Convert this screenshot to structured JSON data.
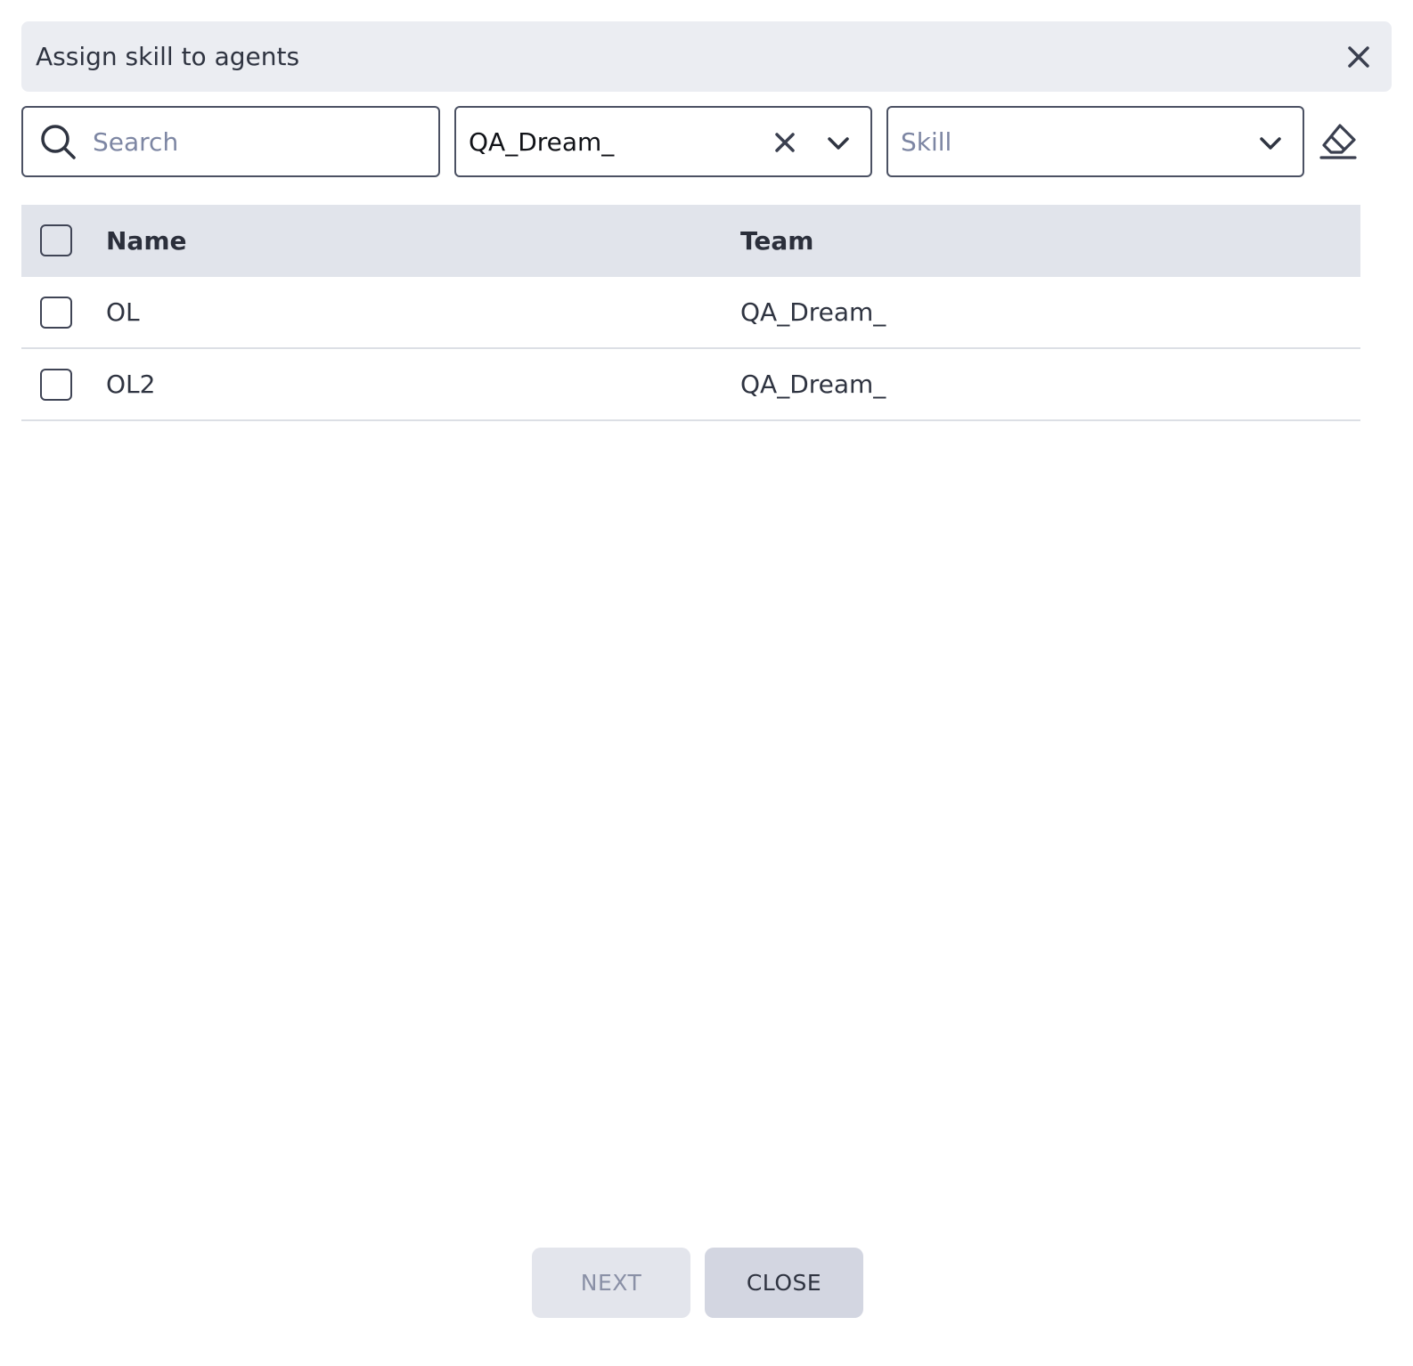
{
  "dialog": {
    "title": "Assign skill to agents"
  },
  "filters": {
    "search_placeholder": "Search",
    "team_value": "QA_Dream_",
    "skill_placeholder": "Skill"
  },
  "table": {
    "columns": [
      "Name",
      "Team"
    ],
    "rows": [
      {
        "name": "OL",
        "team": "QA_Dream_"
      },
      {
        "name": "OL2",
        "team": "QA_Dream_"
      }
    ]
  },
  "footer": {
    "next_label": "NEXT",
    "close_label": "CLOSE"
  },
  "colors": {
    "header_bg": "#ebedf2",
    "table_header_bg": "#e1e4eb",
    "border": "#4b5163",
    "placeholder": "#7d86a3",
    "next_bg": "#e3e5ec",
    "close_bg": "#d3d6e1"
  },
  "icons": [
    "close-icon",
    "search-icon",
    "clear-icon",
    "chevron-down-icon",
    "eraser-icon"
  ]
}
